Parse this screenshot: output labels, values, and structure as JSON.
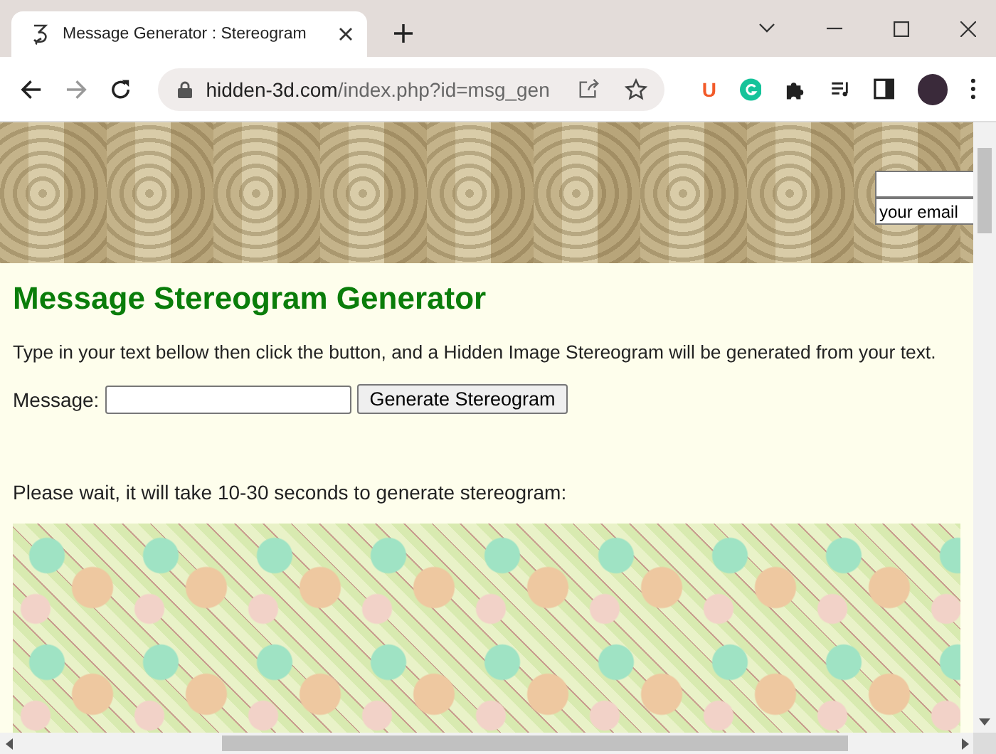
{
  "tabs": [
    {
      "title": "Message Generator : Stereogram",
      "selected": true
    }
  ],
  "address_bar": {
    "host": "hidden-3d.com",
    "path": "/index.php?id=msg_gen"
  },
  "extension_letter": "U",
  "banner": {
    "email_fields": [
      {
        "kind": "blank"
      },
      {
        "kind": "filled",
        "value": "your email"
      }
    ]
  },
  "page": {
    "heading": "Message Stereogram Generator",
    "intro": "Type in your text bellow then click the button, and a Hidden Image Stereogram will be generated from your text.",
    "message_label": "Message:",
    "generate_button": "Generate Stereogram",
    "wait_text": "Please wait, it will take 10-30 seconds to generate stereogram:"
  }
}
